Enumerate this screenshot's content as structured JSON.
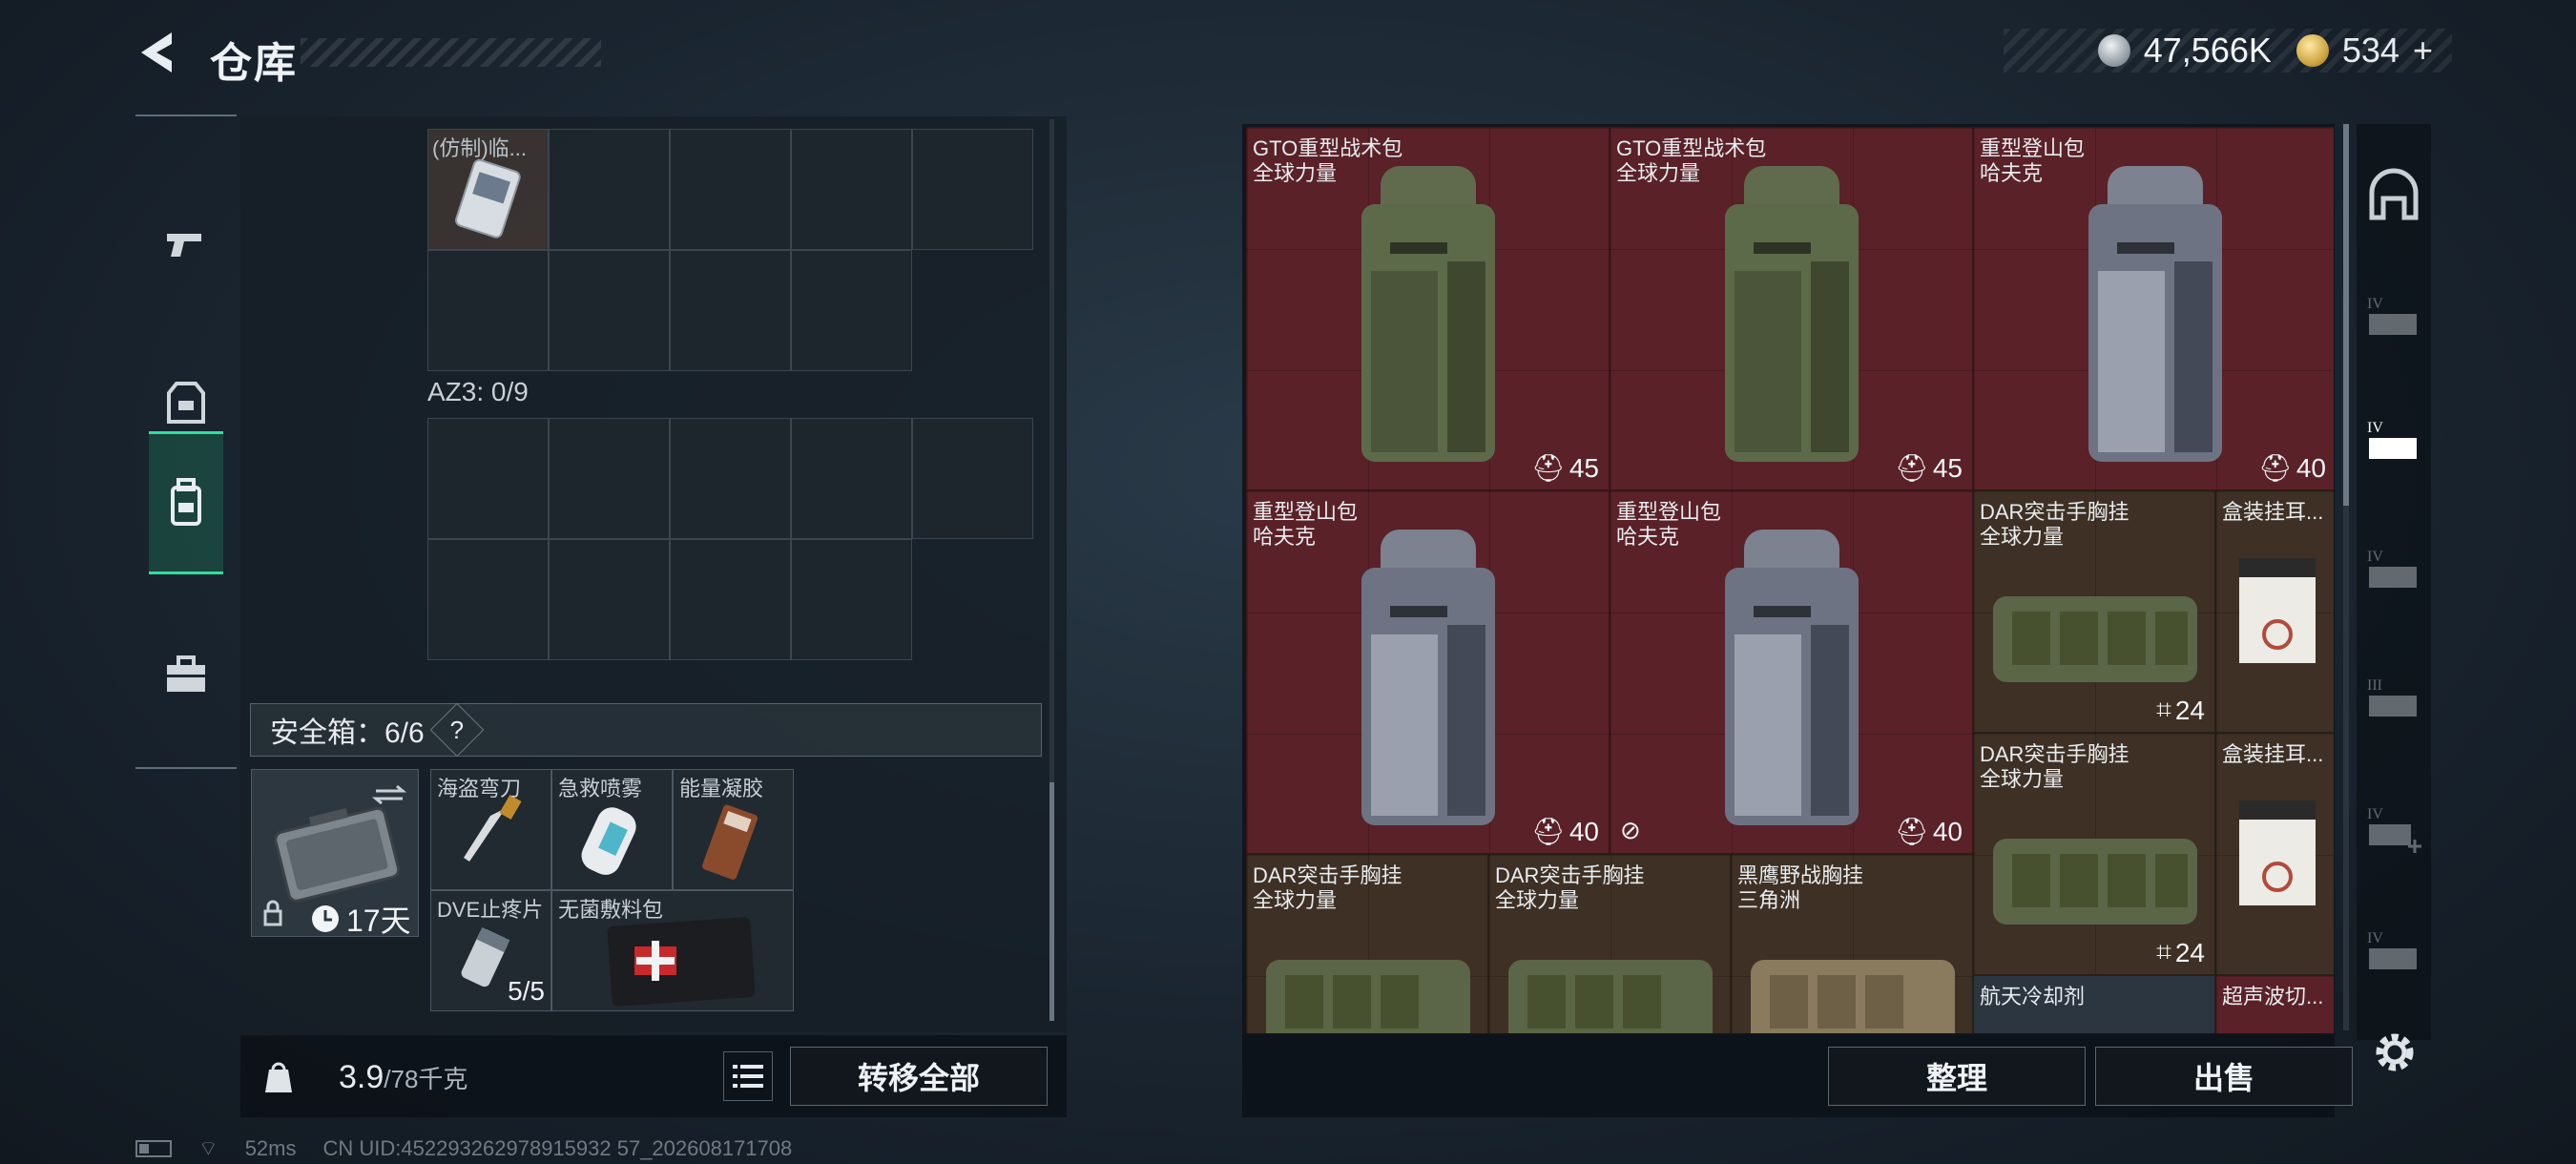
{
  "header": {
    "title": "仓库",
    "currency_silver": "47,566K",
    "currency_gold": "534",
    "currency_gold_add": "+"
  },
  "left_nav": {
    "items": [
      "weapon-icon",
      "armor-icon",
      "backpack-icon",
      "case-icon"
    ],
    "active": "backpack-icon"
  },
  "container": {
    "top_item_label": "(仿制)临...",
    "az3_label": "AZ3: 0/9"
  },
  "safe_box": {
    "label": "安全箱：6/6",
    "help": "?",
    "timer": "17天",
    "items": [
      {
        "name": "海盗弯刀",
        "qty": ""
      },
      {
        "name": "急救喷雾",
        "qty": ""
      },
      {
        "name": "能量凝胶",
        "qty": ""
      },
      {
        "name": "DVE止疼片",
        "qty": "5/5"
      },
      {
        "name": "无菌敷料包",
        "qty": ""
      }
    ]
  },
  "footer_left": {
    "weight_value": "3.9",
    "weight_max": "/78千克",
    "transfer_label": "转移全部"
  },
  "stash": [
    {
      "line1": "GTO重型战术包",
      "line2": "全球力量",
      "capacity": "45"
    },
    {
      "line1": "GTO重型战术包",
      "line2": "全球力量",
      "capacity": "45"
    },
    {
      "line1": "重型登山包",
      "line2": "哈夫克",
      "capacity": "40"
    },
    {
      "line1": "重型登山包",
      "line2": "哈夫克",
      "capacity": "40"
    },
    {
      "line1": "重型登山包",
      "line2": "哈夫克",
      "capacity": "40"
    },
    {
      "line1": "DAR突击手胸挂",
      "line2": "全球力量",
      "capacity": "24"
    },
    {
      "line1": "盒装挂耳...",
      "line2": "",
      "capacity": ""
    },
    {
      "line1": "DAR突击手胸挂",
      "line2": "全球力量",
      "capacity": "24"
    },
    {
      "line1": "盒装挂耳...",
      "line2": "",
      "capacity": ""
    },
    {
      "line1": "DAR突击手胸挂",
      "line2": "全球力量",
      "capacity": ""
    },
    {
      "line1": "DAR突击手胸挂",
      "line2": "全球力量",
      "capacity": ""
    },
    {
      "line1": "黑鹰野战胸挂",
      "line2": "三角洲",
      "capacity": ""
    },
    {
      "line1": "航天冷却剂",
      "line2": "",
      "capacity": ""
    },
    {
      "line1": "超声波切...",
      "line2": "",
      "capacity": ""
    }
  ],
  "right_rail": {
    "tiers": [
      "IV",
      "IV",
      "IV",
      "III",
      "IV",
      "IV"
    ]
  },
  "footer_right": {
    "sort_label": "整理",
    "sell_label": "出售"
  },
  "status_bar": {
    "ping": "52ms",
    "uid": "CN UID:452293262978915932 57_202608171708"
  },
  "colors": {
    "accent_green": "#2de0a0",
    "slot_red": "#5a2128",
    "slot_brown": "#3e3024"
  }
}
